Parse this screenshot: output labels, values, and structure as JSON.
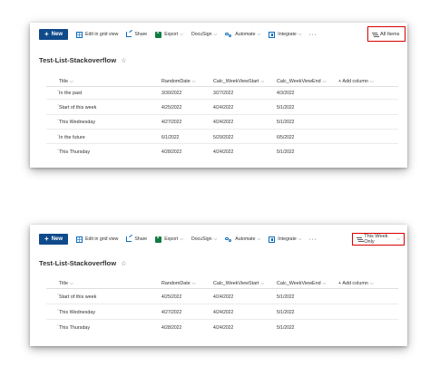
{
  "toolbar": {
    "new_label": "New",
    "grid_label": "Edit in grid view",
    "share_label": "Share",
    "export_label": "Export",
    "docusign_label": "DocuSign",
    "automate_label": "Automate",
    "integrate_label": "Integrate",
    "more_label": "···"
  },
  "list_title": "Test-List-Stackoverflow",
  "star": "☆",
  "columns": {
    "title": "Title",
    "random_date": "RandomDate",
    "week_start": "Calc_WeekViewStart",
    "week_end": "Calc_WeekViewEnd",
    "add_column": "+ Add column"
  },
  "view1": {
    "view_label": "All Items",
    "rows": [
      {
        "title": "In the past",
        "random_date": "3/30/2022",
        "week_start": "3/27/2022",
        "week_end": "4/3/2022"
      },
      {
        "title": "Start of this week",
        "random_date": "4/25/2022",
        "week_start": "4/24/2022",
        "week_end": "5/1/2022"
      },
      {
        "title": "This Wednesday",
        "random_date": "4/27/2022",
        "week_start": "4/24/2022",
        "week_end": "5/1/2022"
      },
      {
        "title": "In the future",
        "random_date": "6/1/2022",
        "week_start": "5/29/2022",
        "week_end": "6/5/2022"
      },
      {
        "title": "This Thursday",
        "random_date": "4/28/2022",
        "week_start": "4/24/2022",
        "week_end": "5/1/2022"
      }
    ]
  },
  "view2": {
    "view_label": "This Week Only",
    "rows": [
      {
        "title": "Start of this week",
        "random_date": "4/25/2022",
        "week_start": "4/24/2022",
        "week_end": "5/1/2022"
      },
      {
        "title": "This Wednesday",
        "random_date": "4/27/2022",
        "week_start": "4/24/2022",
        "week_end": "5/1/2022"
      },
      {
        "title": "This Thursday",
        "random_date": "4/28/2022",
        "week_start": "4/24/2022",
        "week_end": "5/1/2022"
      }
    ]
  },
  "colors": {
    "accent": "#0f4a8a",
    "highlight_border": "#d90000"
  }
}
